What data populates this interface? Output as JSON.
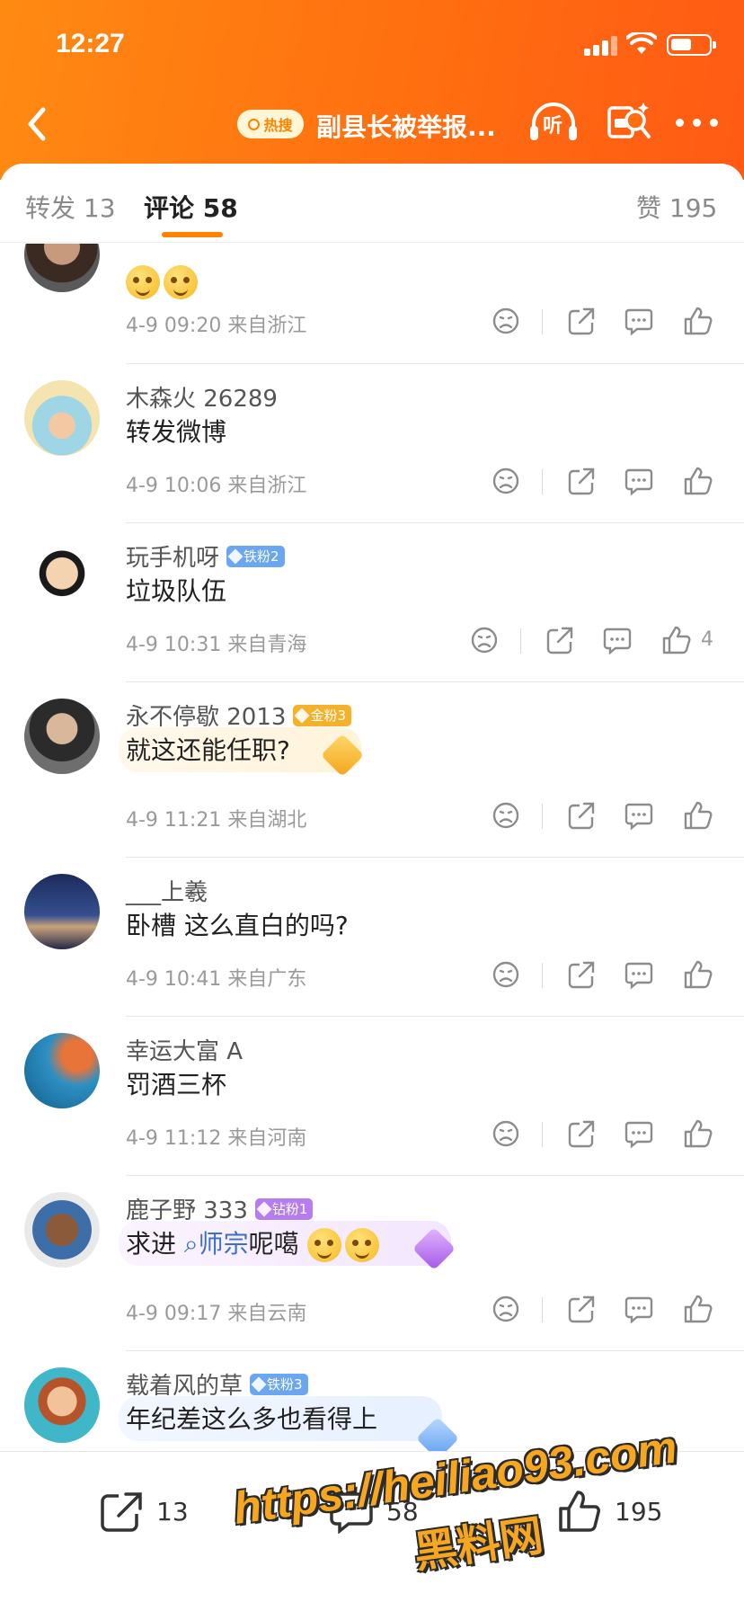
{
  "status_bar": {
    "time": "12:27"
  },
  "nav": {
    "hot_badge": "热搜",
    "title": "副县长被举报...",
    "listen_label": "听"
  },
  "tabs": {
    "repost": "转发 13",
    "comments": "评论 58",
    "likes": "赞 195"
  },
  "comments": [
    {
      "name": "",
      "text": "",
      "meta": "4-9 09:20 来自浙江",
      "like_count": "",
      "badge": ""
    },
    {
      "name": "木森火 26289",
      "text": "转发微博",
      "meta": "4-9 10:06 来自浙江",
      "like_count": "",
      "badge": ""
    },
    {
      "name": "玩手机呀",
      "badge": "铁粉2",
      "text": "垃圾队伍",
      "meta": "4-9 10:31 来自青海",
      "like_count": "4"
    },
    {
      "name": "永不停歇 2013",
      "badge": "金粉3",
      "text": "就这还能任职?",
      "meta": "4-9 11:21 来自湖北",
      "like_count": ""
    },
    {
      "name": "___上羲",
      "badge": "",
      "text": "卧槽 这么直白的吗?",
      "meta": "4-9 10:41 来自广东",
      "like_count": ""
    },
    {
      "name": "幸运大富 A",
      "badge": "",
      "text": "罚酒三杯",
      "meta": "4-9 11:12 来自河南",
      "like_count": ""
    },
    {
      "name": "鹿子野 333",
      "badge": "钻粉1",
      "text_before": "求进 ",
      "hashtag": "师宗",
      "text_after": "呢噶",
      "meta": "4-9 09:17 来自云南",
      "like_count": ""
    },
    {
      "name": "载着风的草",
      "badge": "铁粉3",
      "text": "年纪差这么多也看得上",
      "meta": "",
      "like_count": ""
    }
  ],
  "bottom_bar": {
    "repost_count": "13",
    "comment_count": "58",
    "like_count": "195"
  },
  "watermark": {
    "url": "https://heiliao93.com",
    "name": "黑料网"
  },
  "colors": {
    "header_orange": "#ff7010",
    "accent": "#ff8200",
    "link_blue": "#3b6fc9"
  }
}
